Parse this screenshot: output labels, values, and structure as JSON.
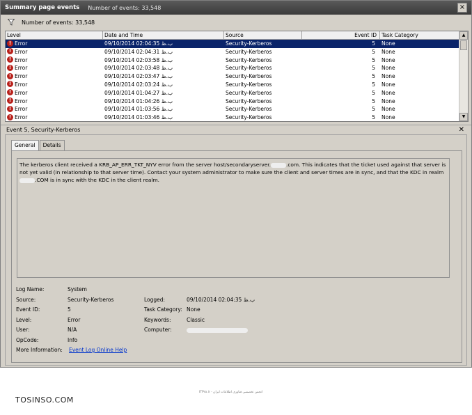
{
  "titlebar": {
    "title": "Summary page events",
    "count": "Number of events: 33,548"
  },
  "filterbar": {
    "count": "Number of events: 33,548"
  },
  "grid": {
    "columns": [
      "Level",
      "Date and Time",
      "Source",
      "Event ID",
      "Task Category"
    ],
    "rows": [
      {
        "level": "Error",
        "date": "09/10/2014 02:04:35 ب.ظ",
        "source": "Security-Kerberos",
        "id": "5",
        "task": "None"
      },
      {
        "level": "Error",
        "date": "09/10/2014 02:04:31 ب.ظ",
        "source": "Security-Kerberos",
        "id": "5",
        "task": "None"
      },
      {
        "level": "Error",
        "date": "09/10/2014 02:03:58 ب.ظ",
        "source": "Security-Kerberos",
        "id": "5",
        "task": "None"
      },
      {
        "level": "Error",
        "date": "09/10/2014 02:03:48 ب.ظ",
        "source": "Security-Kerberos",
        "id": "5",
        "task": "None"
      },
      {
        "level": "Error",
        "date": "09/10/2014 02:03:47 ب.ظ",
        "source": "Security-Kerberos",
        "id": "5",
        "task": "None"
      },
      {
        "level": "Error",
        "date": "09/10/2014 02:03:24 ب.ظ",
        "source": "Security-Kerberos",
        "id": "5",
        "task": "None"
      },
      {
        "level": "Error",
        "date": "09/10/2014 01:04:27 ب.ظ",
        "source": "Security-Kerberos",
        "id": "5",
        "task": "None"
      },
      {
        "level": "Error",
        "date": "09/10/2014 01:04:26 ب.ظ",
        "source": "Security-Kerberos",
        "id": "5",
        "task": "None"
      },
      {
        "level": "Error",
        "date": "09/10/2014 01:03:56 ب.ظ",
        "source": "Security-Kerberos",
        "id": "5",
        "task": "None"
      },
      {
        "level": "Error",
        "date": "09/10/2014 01:03:46 ب.ظ",
        "source": "Security-Kerberos",
        "id": "5",
        "task": "None"
      }
    ]
  },
  "detail": {
    "header": "Event 5, Security-Kerberos",
    "tabs": [
      "General",
      "Details"
    ],
    "description": {
      "part1": "The kerberos client received a KRB_AP_ERR_TKT_NYV error from the server host/secondaryserver.",
      "part2": ".com. This indicates that the ticket used against that server is not yet valid (in relationship to that server time).  Contact your system administrator to make sure the client and server times are in sync, and that the KDC in realm ",
      "part3": ".COM is in sync with the KDC in the client realm."
    },
    "props": {
      "log_name_label": "Log Name:",
      "log_name": "System",
      "source_label": "Source:",
      "source": "Security-Kerberos",
      "logged_label": "Logged:",
      "logged": "09/10/2014 02:04:35 ب.ظ",
      "event_id_label": "Event ID:",
      "event_id": "5",
      "task_category_label": "Task Category:",
      "task_category": "None",
      "level_label": "Level:",
      "level": "Error",
      "keywords_label": "Keywords:",
      "keywords": "Classic",
      "user_label": "User:",
      "user": "N/A",
      "computer_label": "Computer:",
      "opcode_label": "OpCode:",
      "opcode": "Info",
      "more_info_label": "More Information:",
      "more_info_link": "Event Log Online Help"
    }
  },
  "footer": {
    "brand": "TOSINSO.COM",
    "tagline": "ITPro.ir - انجمن تخصصی فناوری اطلاعات ایران"
  }
}
